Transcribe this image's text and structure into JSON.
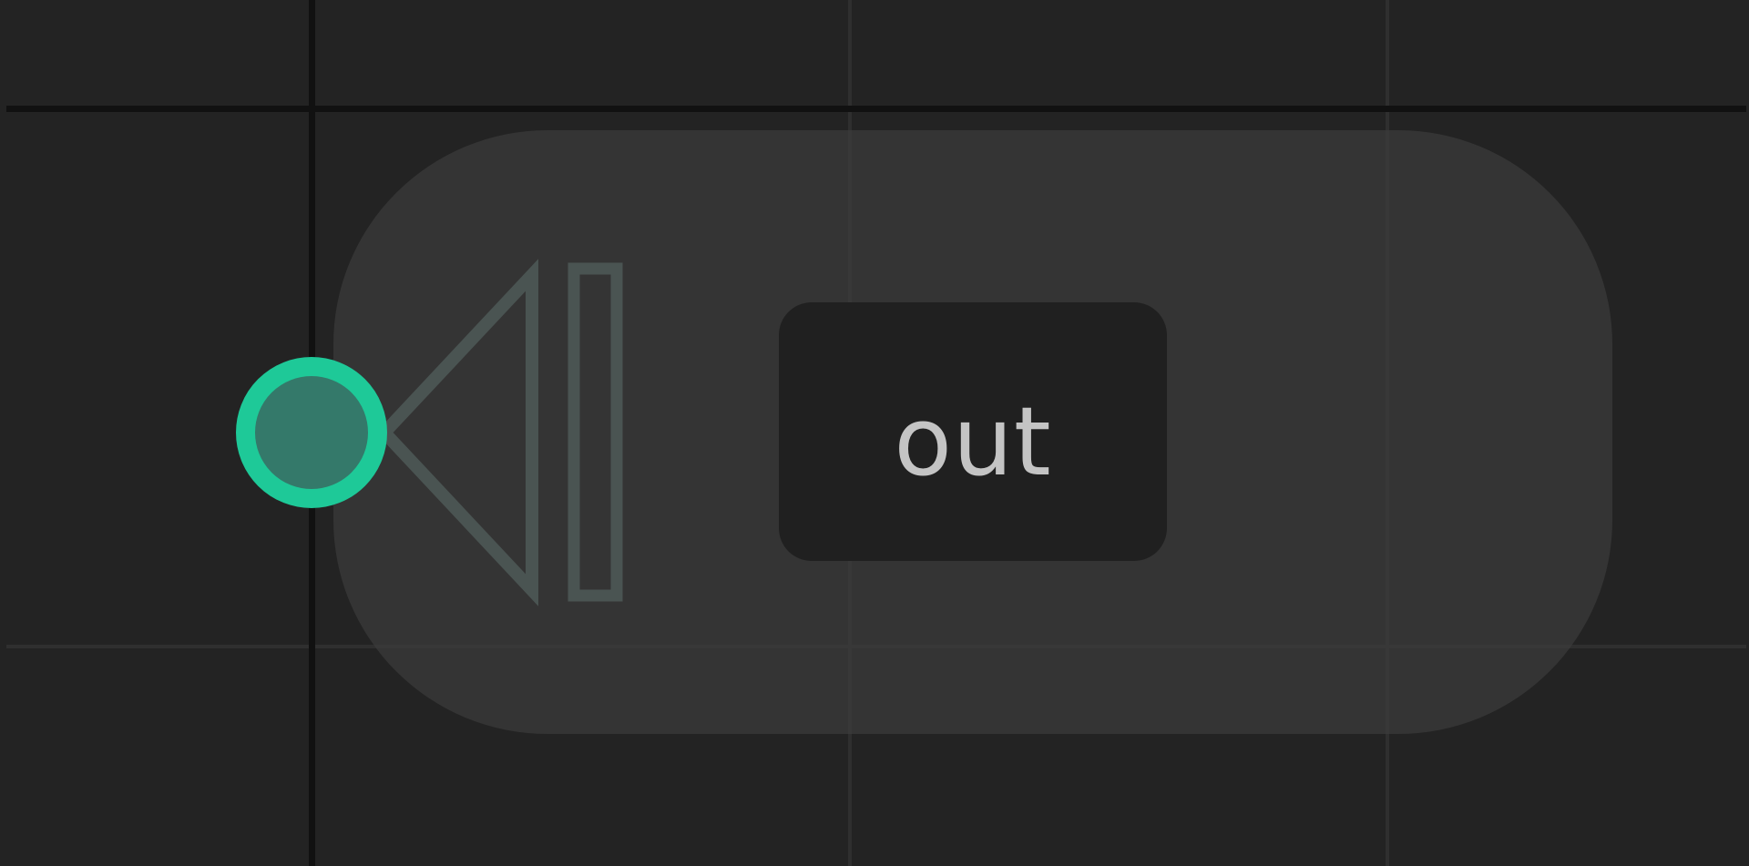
{
  "editor": {
    "background_color": "#232323"
  },
  "node": {
    "type": "output-node",
    "label": "out",
    "body_color": "#383838",
    "label_box_color": "#202020",
    "label_text_color": "#c4c4c4"
  },
  "port": {
    "direction": "input",
    "icon": "output-port-arrow-icon",
    "icon_color": "#4a5452",
    "socket_icon": "socket-circle-icon",
    "socket_border_color": "#1ec998",
    "socket_fill_color": "#34796a"
  }
}
